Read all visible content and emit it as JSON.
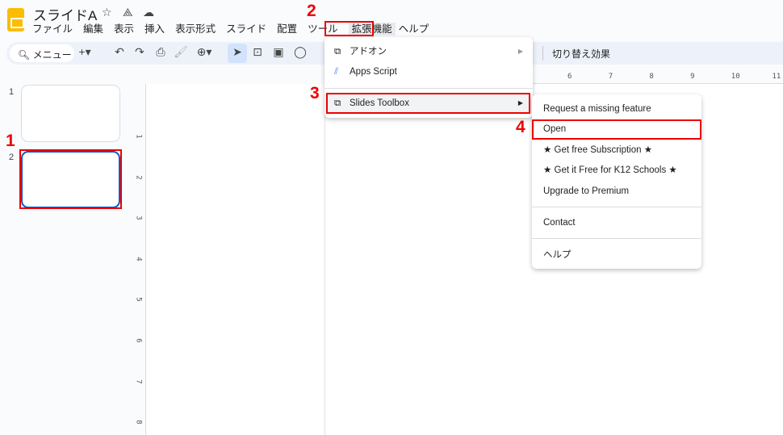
{
  "app": {
    "title": "スライドA",
    "icons": [
      "star-icon",
      "move-to-drive-icon",
      "cloud-saved-icon"
    ]
  },
  "menubar": [
    "ファイル",
    "編集",
    "表示",
    "挿入",
    "表示形式",
    "スライド",
    "配置",
    "ツール",
    "拡張機能",
    "ヘルプ"
  ],
  "toolbar": {
    "search_label": "メニュー",
    "transition_label": "切り替え効果"
  },
  "slides": [
    {
      "number": "1"
    },
    {
      "number": "2"
    }
  ],
  "ruler": {
    "h": [
      "6",
      "7",
      "8",
      "9",
      "10",
      "11"
    ],
    "v": [
      "1",
      "2",
      "3",
      "4",
      "5",
      "6",
      "7",
      "8"
    ]
  },
  "extensions_menu": {
    "items": [
      {
        "label": "アドオン",
        "icon": "addon-icon",
        "submenu": true
      },
      {
        "label": "Apps Script",
        "icon": "apps-script-icon"
      },
      {
        "label": "Slides Toolbox",
        "icon": "addon-icon",
        "submenu": true
      }
    ]
  },
  "submenu": {
    "items": [
      "Request a missing feature",
      "Open",
      "★ Get free Subscription ★",
      "★ Get it Free for K12 Schools ★",
      "Upgrade to Premium",
      "Contact",
      "ヘルプ"
    ]
  },
  "annotations": [
    "1",
    "2",
    "3",
    "4"
  ],
  "colors": {
    "annotation": "#ee0000",
    "accent": "#d3e3fd",
    "logo": "#fbbc04"
  }
}
